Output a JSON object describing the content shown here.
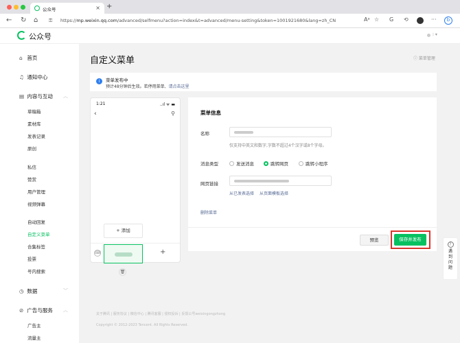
{
  "browser": {
    "tab_title": "公众号",
    "url_prefix": "https://",
    "url_host": "mp.weixin.qq.com",
    "url_path": "/advanced/selfmenu?action=index&t=advanced/menu-setting&token=1001921680&lang=zh_CN",
    "colors": {
      "red": "#ff5f57",
      "yellow": "#febc2e",
      "green": "#28c840"
    }
  },
  "header": {
    "logo_text": "公众号"
  },
  "sidebar": {
    "home": "首页",
    "notifications": "通知中心",
    "content_group": "内容与互动",
    "drafts": "草稿箱",
    "materials": "素材库",
    "published": "发表记录",
    "original": "原创",
    "messages": "私信",
    "likes": "赞赏",
    "user_management": "用户管理",
    "danmaku": "视频弹幕",
    "auto_reply": "自动回复",
    "custom_menu": "自定义菜单",
    "collection_tags": "合集标签",
    "vote": "投票",
    "search": "号内搜索",
    "data_group": "数据",
    "ads_group": "广告与服务",
    "advertiser": "广告主",
    "publisher": "流量主"
  },
  "main": {
    "title": "自定义菜单",
    "help_link": "菜单管理",
    "notice_title": "菜单发布中",
    "notice_desc": "预计48分钟后生效。若停用菜单,",
    "notice_link": "请点击这里"
  },
  "phone": {
    "time": "1:21",
    "status": "..ıl ᯤ ▬",
    "add_label": "添加"
  },
  "form": {
    "title": "菜单信息",
    "name_label": "名称",
    "name_hint": "仅支持中英文和数字,字数不超过4个汉字或8个字母。",
    "msg_type_label": "消息类型",
    "option_send": "发送消息",
    "option_webpage": "跳转网页",
    "option_miniprogram": "跳转小程序",
    "url_label": "网页链接",
    "link_published": "从已发表选择",
    "link_template": "从页面模板选择",
    "delete_menu": "删除菜单",
    "preview": "预览",
    "save_publish": "保存并发布"
  },
  "footer": {
    "links": "关于腾讯 | 服务协议 | 微信中心 | 腾讯客服 | 侵权投诉 | 反馈公号weixingongzhong",
    "copyright": "Copyright © 2012-2023 Tencent. All Rights Reserved."
  },
  "float_help": {
    "label": "遇到问题"
  }
}
